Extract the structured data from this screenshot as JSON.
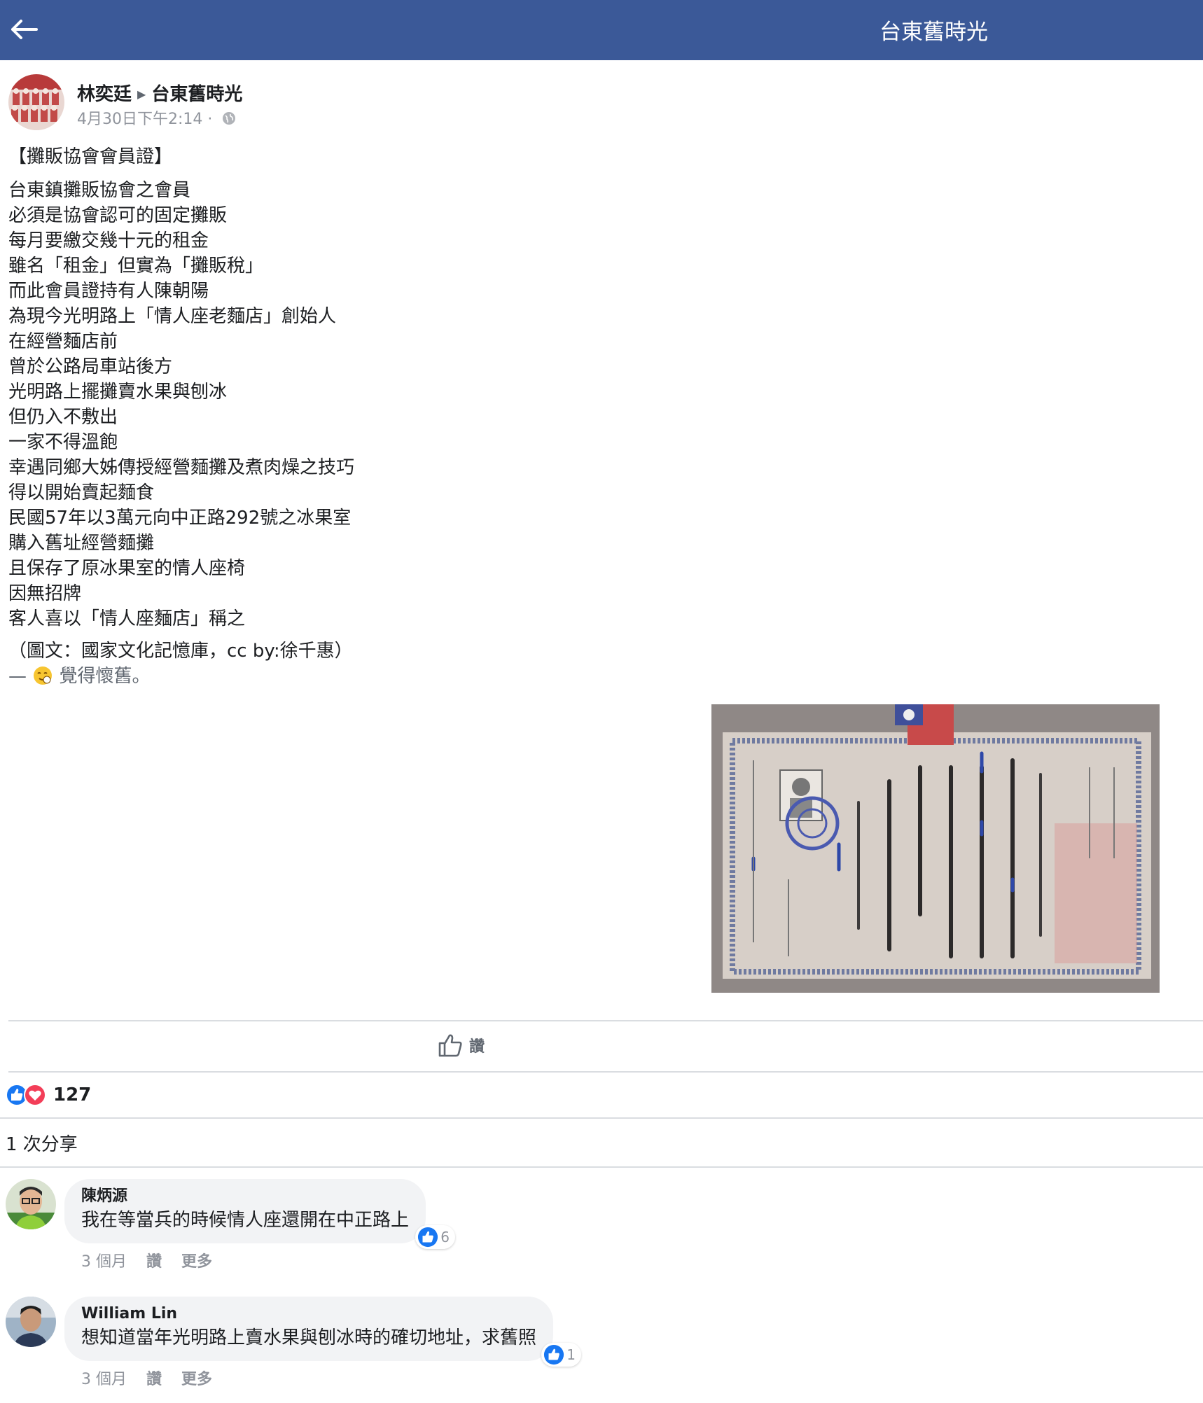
{
  "topbar": {
    "title": "台東舊時光",
    "back_icon": "arrow-left-icon"
  },
  "colors": {
    "brand_blue": "#3b5998",
    "like_blue": "#1877f2",
    "love_red": "#f33e58",
    "secondary_text": "#90949c"
  },
  "post": {
    "author": "林奕廷",
    "group": "台東舊時光",
    "timestamp": "4月30日下午2:14 ·",
    "privacy_icon": "globe-icon",
    "title": "【攤販協會會員證】",
    "lines": [
      "台東鎮攤販協會之會員",
      "必須是協會認可的固定攤販",
      "每月要繳交幾十元的租金",
      "雖名「租金」但實為「攤販稅」",
      "而此會員證持有人陳朝陽",
      "為現今光明路上「情人座老麵店」創始人",
      "在經營麵店前",
      "曾於公路局車站後方",
      "光明路上擺攤賣水果與刨冰",
      "但仍入不敷出",
      "一家不得溫飽",
      "幸遇同鄉大姊傳授經營麵攤及煮肉燥之技巧",
      "得以開始賣起麵食",
      "民國57年以3萬元向中正路292號之冰果室",
      "購入舊址經營麵攤",
      "且保存了原冰果室的情人座椅",
      "因無招牌",
      "客人喜以「情人座麵店」稱之"
    ],
    "credit": "（圖文：國家文化記憶庫，cc by:徐千惠）",
    "feeling_prefix": "—",
    "feeling_text": "覺得懷舊。",
    "like_label": "讚",
    "reaction_count": "127",
    "shares_text": "1 次分享"
  },
  "comments": [
    {
      "author": "陳炳源",
      "text": "我在等當兵的時候情人座還開在中正路上",
      "likes": "6",
      "time": "3 個月",
      "like_action": "讚",
      "more_action": "更多"
    },
    {
      "author": "William Lin",
      "text": "想知道當年光明路上賣水果與刨冰時的確切地址，求舊照",
      "likes": "1",
      "time": "3 個月",
      "like_action": "讚",
      "more_action": "更多"
    }
  ]
}
